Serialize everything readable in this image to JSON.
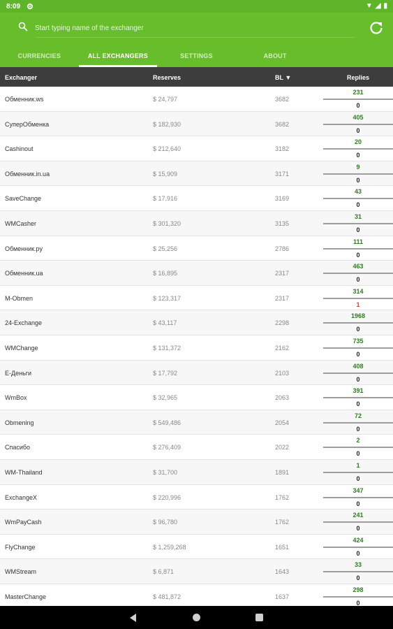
{
  "status": {
    "time": "8:09"
  },
  "search": {
    "placeholder": "Start typing name of the exchanger"
  },
  "tabs": [
    {
      "label": "CURRENCIES"
    },
    {
      "label": "ALL EXCHANGERS"
    },
    {
      "label": "SETTINGS"
    },
    {
      "label": "ABOUT"
    }
  ],
  "table": {
    "headers": {
      "exchanger": "Exchanger",
      "reserves": "Reserves",
      "bl": "BL ▼",
      "replies": "Replies"
    },
    "rows": [
      {
        "name": "Обменник.ws",
        "reserve": "$ 24,797",
        "bl": "3682",
        "positive": "231",
        "negative": "0"
      },
      {
        "name": "СуперОбменка",
        "reserve": "$ 182,930",
        "bl": "3682",
        "positive": "405",
        "negative": "0"
      },
      {
        "name": "Cashinout",
        "reserve": "$ 212,640",
        "bl": "3182",
        "positive": "20",
        "negative": "0"
      },
      {
        "name": "Обменник.in.ua",
        "reserve": "$ 15,909",
        "bl": "3171",
        "positive": "9",
        "negative": "0"
      },
      {
        "name": "SaveChange",
        "reserve": "$ 17,916",
        "bl": "3169",
        "positive": "43",
        "negative": "0"
      },
      {
        "name": "WMCasher",
        "reserve": "$ 301,320",
        "bl": "3135",
        "positive": "31",
        "negative": "0"
      },
      {
        "name": "Обменник.ру",
        "reserve": "$ 25,256",
        "bl": "2786",
        "positive": "111",
        "negative": "0"
      },
      {
        "name": "Обменник.ua",
        "reserve": "$ 16,895",
        "bl": "2317",
        "positive": "463",
        "negative": "0"
      },
      {
        "name": "M-Obmen",
        "reserve": "$ 123,317",
        "bl": "2317",
        "positive": "314",
        "negative": "1"
      },
      {
        "name": "24-Exchange",
        "reserve": "$ 43,117",
        "bl": "2298",
        "positive": "1968",
        "negative": "0"
      },
      {
        "name": "WMChange",
        "reserve": "$ 131,372",
        "bl": "2162",
        "positive": "735",
        "negative": "0"
      },
      {
        "name": "E-Деньги",
        "reserve": "$ 17,792",
        "bl": "2103",
        "positive": "408",
        "negative": "0"
      },
      {
        "name": "WmBox",
        "reserve": "$ 32,965",
        "bl": "2063",
        "positive": "391",
        "negative": "0"
      },
      {
        "name": "Obmening",
        "reserve": "$ 549,486",
        "bl": "2054",
        "positive": "72",
        "negative": "0"
      },
      {
        "name": "Спасибо",
        "reserve": "$ 276,409",
        "bl": "2022",
        "positive": "2",
        "negative": "0"
      },
      {
        "name": "WM-Thailand",
        "reserve": "$ 31,700",
        "bl": "1891",
        "positive": "1",
        "negative": "0"
      },
      {
        "name": "ExchangeX",
        "reserve": "$ 220,996",
        "bl": "1762",
        "positive": "347",
        "negative": "0"
      },
      {
        "name": "WmPayCash",
        "reserve": "$ 96,780",
        "bl": "1762",
        "positive": "241",
        "negative": "0"
      },
      {
        "name": "FlyChange",
        "reserve": "$ 1,259,268",
        "bl": "1651",
        "positive": "424",
        "negative": "0"
      },
      {
        "name": "WMStream",
        "reserve": "$ 6,871",
        "bl": "1643",
        "positive": "33",
        "negative": "0"
      },
      {
        "name": "MasterChange",
        "reserve": "$ 481,872",
        "bl": "1637",
        "positive": "298",
        "negative": "0"
      }
    ]
  },
  "colors": {
    "app_bar": "#68bd2b",
    "status_bar": "#5fb52a",
    "header": "#3d3d3d",
    "positive": "#2e7d1f",
    "negative": "#e53935"
  }
}
